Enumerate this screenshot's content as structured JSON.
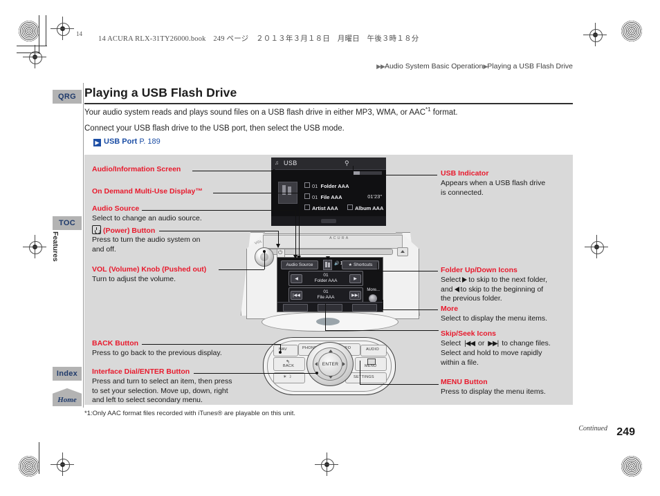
{
  "print": {
    "running_head": "14 ACURA RLX-31TY26000.book　249 ページ　２０１３年３月１８日　月曜日　午後３時１８分",
    "corner_number": "14"
  },
  "breadcrumb": {
    "marker": "▶▶",
    "level1": "Audio System Basic Operation",
    "separator": "▶",
    "level2": "Playing a USB Flash Drive"
  },
  "sidebar": {
    "qrg": "QRG",
    "toc": "TOC",
    "features": "Features",
    "index": "Index",
    "home": "Home"
  },
  "page": {
    "title": "Playing a USB Flash Drive",
    "intro1_a": "Your audio system reads and plays sound files on a USB flash drive in either MP3, WMA, or AAC",
    "intro1_sup": "*1",
    "intro1_b": " format.",
    "intro2": "Connect your USB flash drive to the USB port, then select the USB mode.",
    "xref_icon": "▶",
    "xref_label": "USB Port",
    "xref_page": "P. 189",
    "footnote": "*1:Only AAC format files recorded with iTunes® are playable on this unit.",
    "continued": "Continued",
    "folio": "249"
  },
  "annotations": {
    "audio_info_screen": {
      "heading": "Audio/Information Screen"
    },
    "odmd": {
      "heading": "On Demand Multi-Use Display™"
    },
    "audio_source": {
      "heading": "Audio Source",
      "body": "Select to change an audio source."
    },
    "power_button": {
      "heading": "(Power) Button",
      "body_line1": "Press to turn the audio system on",
      "body_line2": "and off."
    },
    "vol_knob": {
      "heading": "VOL (Volume) Knob (Pushed out)",
      "body": "Turn to adjust the volume."
    },
    "back_button": {
      "heading": "BACK Button",
      "body": "Press to go back to the previous display."
    },
    "interface_dial": {
      "heading": "Interface Dial/ENTER Button",
      "body_line1": "Press and turn to select an item, then press",
      "body_line2": "to set your selection. Move up, down, right",
      "body_line3": "and left to select secondary menu."
    },
    "usb_indicator": {
      "heading": "USB Indicator",
      "body_line1": "Appears when a USB flash drive",
      "body_line2": "is connected."
    },
    "folder_icons": {
      "heading": "Folder Up/Down Icons",
      "body_a": "Select",
      "body_b": "to skip to the next folder,",
      "body_c": "and",
      "body_d": "to skip to the beginning of",
      "body_e": "the previous folder."
    },
    "more": {
      "heading": "More",
      "body": "Select to display the menu items."
    },
    "skip_seek": {
      "heading": "Skip/Seek Icons",
      "body_a": "Select",
      "icon_prev": "|◀◀",
      "body_or": "or",
      "icon_next": "▶▶|",
      "body_b": "to change files.",
      "body_line2": "Select and hold to move rapidly",
      "body_line3": "within a file."
    },
    "menu_button": {
      "heading": "MENU Button",
      "body": "Press to display the menu items."
    }
  },
  "audio_screen": {
    "note_icon": "♫",
    "source": "USB",
    "usb_icon": "⚲",
    "track_number": "01",
    "folder": "Folder AAA",
    "file_number": "01",
    "file": "File AAA",
    "artist": "Artist AAA",
    "album": "Album AAA",
    "elapsed": "01'23\""
  },
  "odmd_screen": {
    "audio_source_button": "Audio Source",
    "volume_value": "10",
    "shortcuts_button": "Shortcuts",
    "folder_number": "01",
    "folder_name": "Folder AAA",
    "file_number": "01",
    "file_name": "File AAA",
    "more_label": "More...",
    "pad_prev_folder": "◀",
    "pad_next_folder": "▶",
    "pad_prev_track": "|◀◀",
    "pad_next_track": "▶▶|"
  },
  "faceplate": {
    "brand": "ACURA",
    "vol_label": "VOL"
  },
  "control_panel": {
    "nav": "NAV",
    "phone": "PHONE",
    "info": "INFO",
    "audio": "AUDIO",
    "back": "BACK",
    "back_arrow": "↰",
    "enter": "ENTER",
    "menu": "MENU",
    "settings": "SETTINGS",
    "brightness": "☀ ☽"
  },
  "colors": {
    "accent_red": "#e8192c",
    "link_blue": "#1c4ea5",
    "panel_gray": "#d9d9d9",
    "tab_gray": "#b3b3b3"
  }
}
